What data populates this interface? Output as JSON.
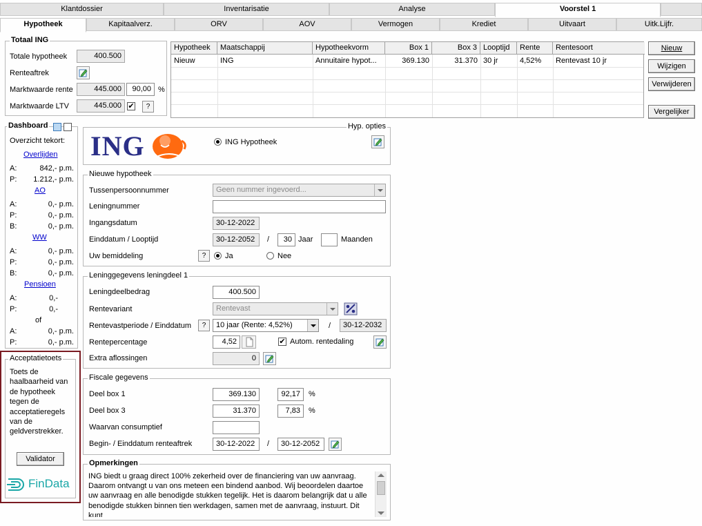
{
  "top_tabs": [
    "Klantdossier",
    "Inventarisatie",
    "Analyse",
    "Voorstel 1"
  ],
  "sub_tabs": [
    "Hypotheek",
    "Kapitaalverz.",
    "ORV",
    "AOV",
    "Vermogen",
    "Krediet",
    "Uitvaart",
    "Uitk.Lijfr."
  ],
  "totaal": {
    "title": "Totaal ING",
    "totale_hypotheek_label": "Totale hypotheek",
    "totale_hypotheek": "400.500",
    "renteaftrek_label": "Renteaftrek",
    "marktwaarde_rente_label": "Marktwaarde rente",
    "marktwaarde_rente": "445.000",
    "marktwaarde_pct": "90,00",
    "pct_sign": "%",
    "marktwaarde_ltv_label": "Marktwaarde LTV",
    "marktwaarde_ltv": "445.000",
    "help": "?"
  },
  "table": {
    "headers": [
      "Hypotheek",
      "Maatschappij",
      "Hypotheekvorm",
      "Box 1",
      "Box 3",
      "Looptijd",
      "Rente",
      "Rentesoort"
    ],
    "rows": [
      [
        "Nieuw",
        "ING",
        "Annuitaire hypot...",
        "369.130",
        "31.370",
        "30 jr",
        "4,52%",
        "Rentevast 10 jr"
      ]
    ]
  },
  "buttons": {
    "nieuw": "Nieuw",
    "wijzigen": "Wijzigen",
    "verwijderen": "Verwijderen",
    "vergelijker": "Vergelijker",
    "validator": "Validator"
  },
  "dashboard": {
    "title": "Dashboard",
    "overzicht": "Overzicht tekort:",
    "overlijden": "Overlijden",
    "overlijden_rows": [
      [
        "A:",
        "842,- p.m."
      ],
      [
        "P:",
        "1.212,- p.m."
      ]
    ],
    "ao": "AO",
    "ao_rows": [
      [
        "A:",
        "0,- p.m."
      ],
      [
        "P:",
        "0,- p.m."
      ],
      [
        "B:",
        "0,- p.m."
      ]
    ],
    "ww": "WW",
    "ww_rows": [
      [
        "A:",
        "0,- p.m."
      ],
      [
        "P:",
        "0,- p.m."
      ],
      [
        "B:",
        "0,- p.m."
      ]
    ],
    "pensioen": "Pensioen",
    "pensioen_rows": [
      [
        "A:",
        "0,-"
      ],
      [
        "P:",
        "0,-"
      ]
    ],
    "of": "of",
    "pensioen_rows2": [
      [
        "A:",
        "0,- p.m."
      ],
      [
        "P:",
        "0,- p.m."
      ]
    ]
  },
  "acceptatie": {
    "title": "Acceptatietoets",
    "text": "Toets de haalbaarheid van de hypotheek tegen de acceptatieregels van de geldverstrekker.",
    "brand": "FinData"
  },
  "hyp_opties": {
    "title": "Hyp. opties",
    "logo_text": "ING",
    "radio_label": "ING Hypotheek"
  },
  "nieuwe": {
    "title": "Nieuwe hypotheek",
    "tussen_label": "Tussenpersoonnummer",
    "tussen_placeholder": "Geen nummer ingevoerd...",
    "lening_label": "Leningnummer",
    "lening_value": "",
    "ingang_label": "Ingangsdatum",
    "ingang_value": "30-12-2022",
    "eind_label": "Einddatum / Looptijd",
    "eind_value": "30-12-2052",
    "slash": "/",
    "jaar_value": "30",
    "jaar_label": "Jaar",
    "maanden_value": "",
    "maanden_label": "Maanden",
    "bemid_label": "Uw bemiddeling",
    "ja": "Ja",
    "nee": "Nee"
  },
  "lening": {
    "title": "Leninggegevens leningdeel 1",
    "bedrag_label": "Leningdeelbedrag",
    "bedrag_value": "400.500",
    "variant_label": "Rentevariant",
    "variant_value": "Rentevast",
    "periode_label": "Rentevastperiode / Einddatum",
    "periode_value": "10 jaar (Rente: 4,52%)",
    "periode_eind": "30-12-2032",
    "pct_label": "Rentepercentage",
    "pct_value": "4,52",
    "autom_label": "Autom. rentedaling",
    "extra_label": "Extra aflossingen",
    "extra_value": "0"
  },
  "fiscaal": {
    "title": "Fiscale gegevens",
    "box1_label": "Deel box 1",
    "box1_value": "369.130",
    "box1_pct": "92,17",
    "box3_label": "Deel box 3",
    "box3_value": "31.370",
    "box3_pct": "7,83",
    "pct_sign": "%",
    "consumptief_label": "Waarvan consumptief",
    "consumptief_value": "",
    "renteaftrek_label": "Begin- / Einddatum renteaftrek",
    "renteaftrek_begin": "30-12-2022",
    "renteaftrek_eind": "30-12-2052"
  },
  "opmerkingen": {
    "title": "Opmerkingen",
    "text": "ING biedt u graag direct 100% zekerheid over de financiering van uw aanvraag. Daarom ontvangt u van ons meteen een bindend aanbod. Wij beoordelen daartoe uw aanvraag en alle benodigde stukken tegelijk. Het is daarom belangrijk dat u alle benodigde stukken binnen tien werkdagen, samen met de aanvraag, instuurt. Dit kunt"
  },
  "colors": {
    "ing_blue": "#2b2f87",
    "ing_orange": "#ff6a10",
    "findata": "#1aa7a7",
    "highlight_border": "#7a1b22"
  }
}
